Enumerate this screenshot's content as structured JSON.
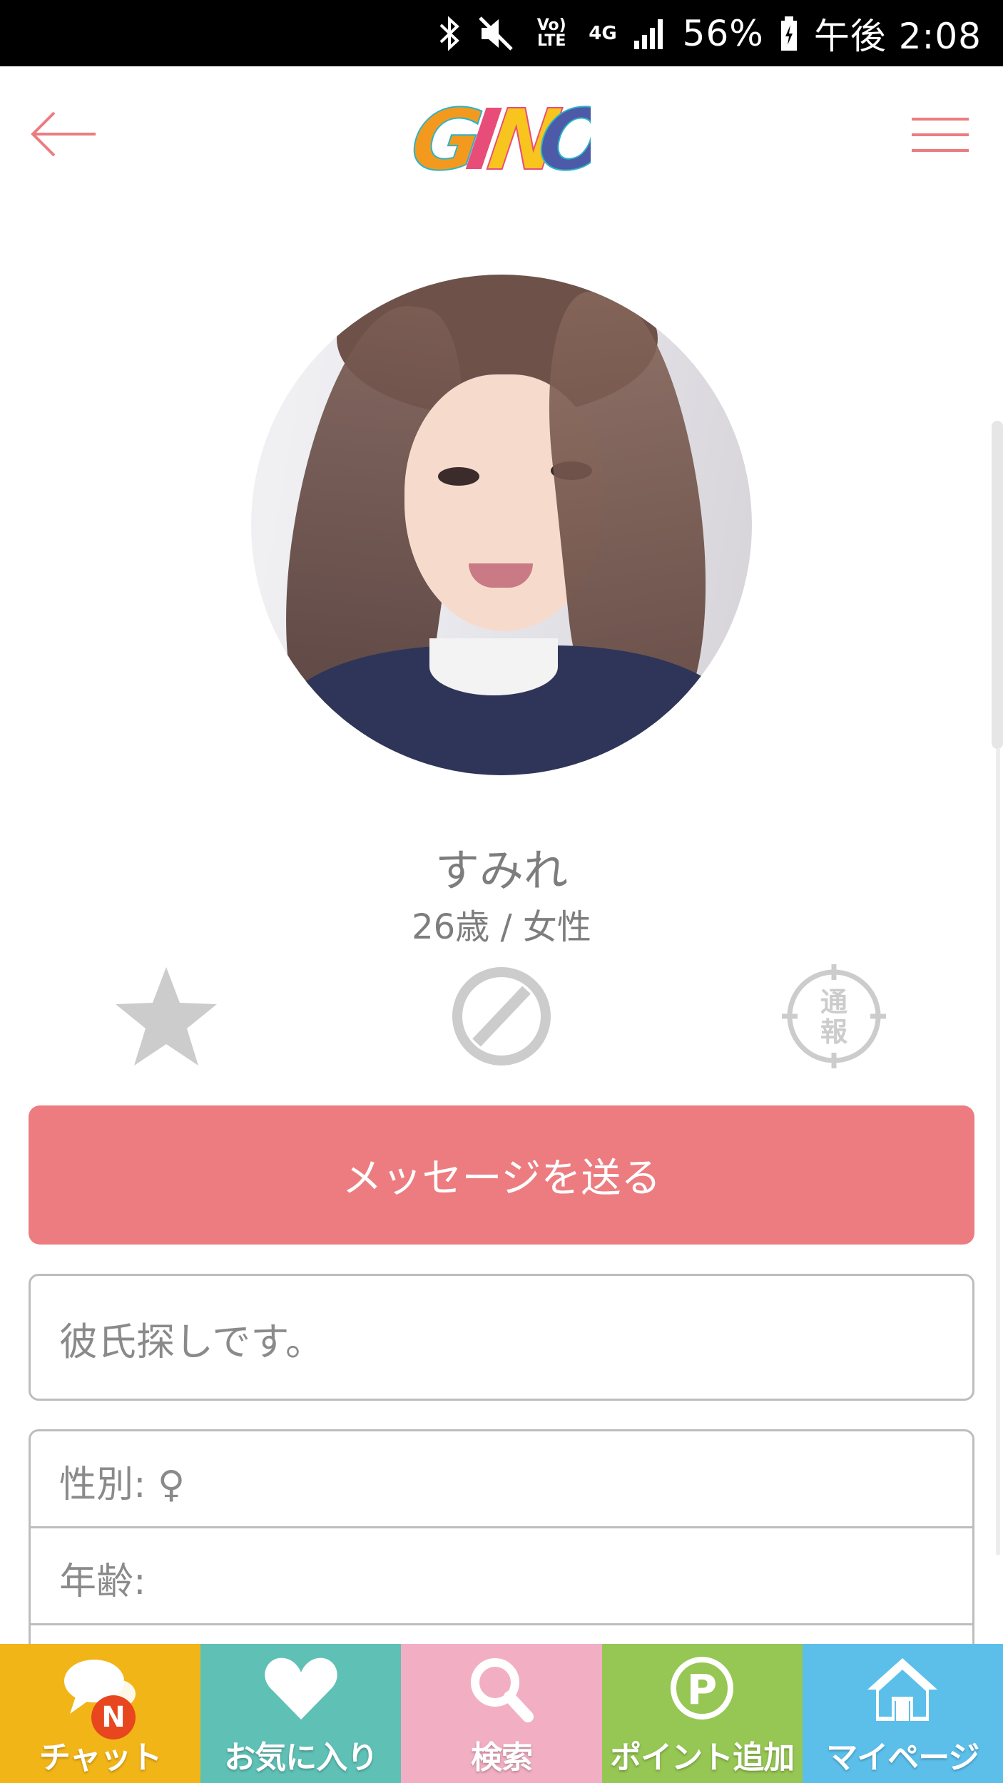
{
  "status_bar": {
    "volte_label": "Vo) LTE",
    "network_label": "4G",
    "battery_percent": "56%",
    "time": "午後 2:08"
  },
  "header": {
    "logo_text": "GINO",
    "logo_colors": [
      "#f39a1e",
      "#2bb3c9",
      "#e84d79",
      "#f7c51e",
      "#4c5aa8"
    ]
  },
  "profile": {
    "name": "すみれ",
    "age_gender": "26歳 / 女性",
    "report_label_1": "通",
    "report_label_2": "報"
  },
  "actions": {
    "favorite_icon": "star-icon",
    "block_icon": "block-icon",
    "report_icon": "report-icon"
  },
  "message_button": {
    "label": "メッセージを送る"
  },
  "bio": "彼氏探しです。",
  "details": [
    {
      "label": "性別: ♀"
    },
    {
      "label": "年齢:"
    }
  ],
  "bottom_nav": {
    "items": [
      {
        "label": "チャット",
        "color": "#f2b518",
        "badge": "N"
      },
      {
        "label": "お気に入り",
        "color": "#5fc0b6"
      },
      {
        "label": "検索",
        "color": "#f2afc4"
      },
      {
        "label": "ポイント追加",
        "color": "#96c653"
      },
      {
        "label": "マイページ",
        "color": "#5cbfea"
      }
    ]
  },
  "colors": {
    "accent": "#ec7c80",
    "icon_gray": "#cccccc",
    "text_gray": "#7d7d7d"
  }
}
